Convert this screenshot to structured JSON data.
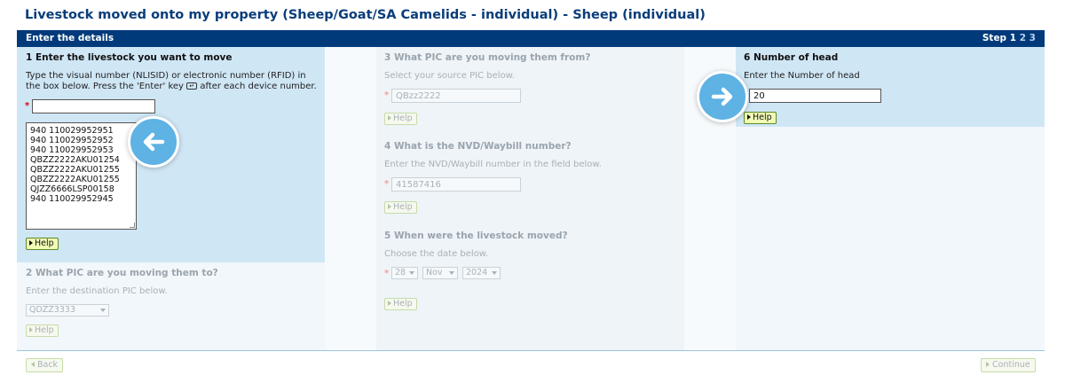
{
  "page": {
    "title": "Livestock moved onto my property (Sheep/Goat/SA Camelids - individual) - Sheep (individual)"
  },
  "header": {
    "title": "Enter the details",
    "step_prefix": "Step",
    "step_current": "1",
    "step_others": "2 3"
  },
  "section1": {
    "title": "1 Enter the livestock you want to move",
    "desc_before_icon": "Type the visual number (NLISID) or electronic number (RFID) in the box below. Press the 'Enter' key",
    "desc_after_icon": "after each device number.",
    "input_value": "",
    "device_list": [
      "940 110029952951",
      "940 110029952952",
      "940 110029952953",
      "QBZZ2222AKU01254",
      "QBZZ2222AKU01255",
      "QBZZ2222AKU01255",
      "QJZZ6666LSP00158",
      "940 110029952945"
    ],
    "help_label": "Help",
    "required_mark": "*",
    "enter_key_icon": "↵"
  },
  "section2": {
    "title": "2 What PIC are you moving them to?",
    "desc": "Enter the destination PIC below.",
    "selected": "QDZZ3333",
    "help_label": "Help"
  },
  "section3": {
    "title": "3 What PIC are you moving them from?",
    "desc": "Select your source PIC below.",
    "value": "QBzz2222",
    "help_label": "Help",
    "required_mark": "*"
  },
  "section4": {
    "title": "4 What is the NVD/Waybill number?",
    "desc": "Enter the NVD/Waybill number in the field below.",
    "value": "41587416",
    "help_label": "Help",
    "required_mark": "*"
  },
  "section5": {
    "title": "5 When were the livestock moved?",
    "desc": "Choose the date below.",
    "day": "28",
    "month": "Nov",
    "year": "2024",
    "help_label": "Help",
    "required_mark": "*"
  },
  "section6": {
    "title": "6 Number of head",
    "desc": "Enter the Number of head",
    "value": "20",
    "help_label": "Help"
  },
  "footer": {
    "back_label": "Back",
    "continue_label": "Continue"
  },
  "colors": {
    "brand_navy": "#003a7a",
    "title_blue": "#0a3d7a",
    "arrow_blue": "#5eb2e4",
    "active_section": "#cfe6f5",
    "help_yellow": "#f1fbb5"
  }
}
